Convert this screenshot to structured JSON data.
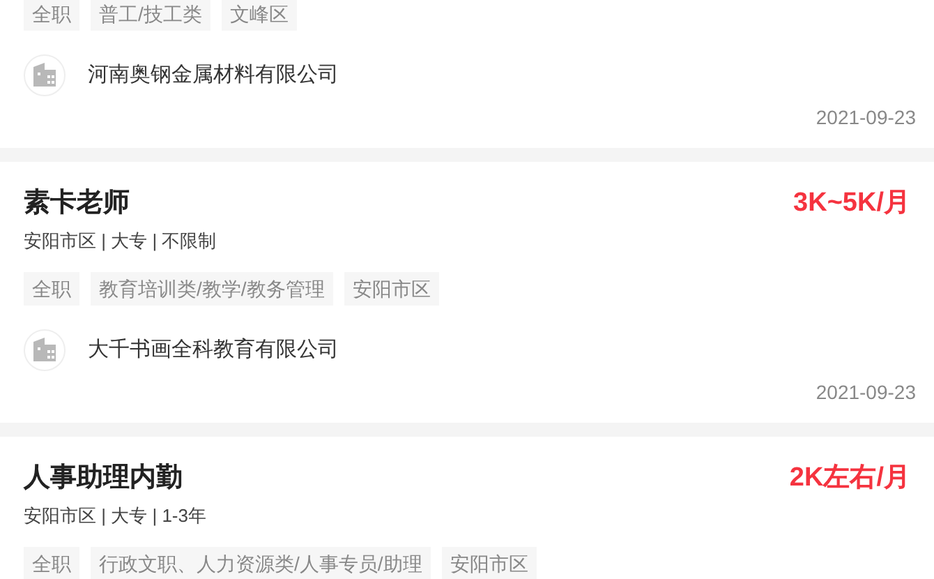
{
  "jobs": [
    {
      "tags": [
        "全职",
        "普工/技工类",
        "文峰区"
      ],
      "company": "河南奥钢金属材料有限公司",
      "date": "2021-09-23"
    },
    {
      "title": "素卡老师",
      "salary": "3K~5K/月",
      "meta": "安阳市区 | 大专 | 不限制",
      "tags": [
        "全职",
        "教育培训类/教学/教务管理",
        "安阳市区"
      ],
      "company": "大千书画全科教育有限公司",
      "date": "2021-09-23"
    },
    {
      "title": "人事助理内勤",
      "salary": "2K左右/月",
      "meta": "安阳市区 | 大专 | 1-3年",
      "tags": [
        "全职",
        "行政文职、人力资源类/人事专员/助理",
        "安阳市区"
      ]
    }
  ]
}
